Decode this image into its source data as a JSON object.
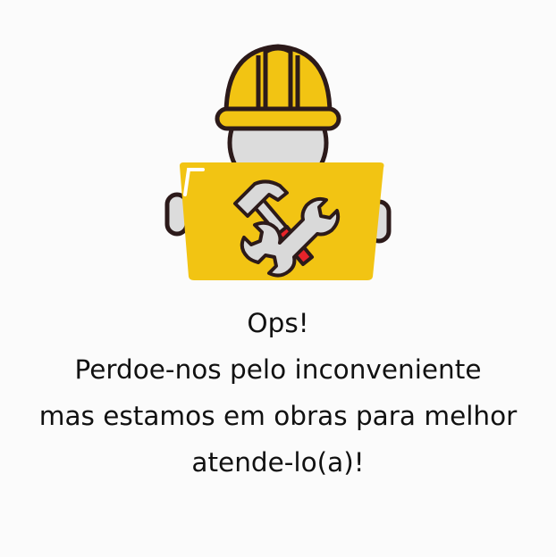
{
  "message": {
    "line1": "Ops!",
    "line2": "Perdoe-nos pelo inconveniente",
    "line3": "mas estamos em obras para melhor",
    "line4": "atende-lo(a)!"
  },
  "illustration": {
    "icon": "construction-worker-icon",
    "tools_icon": "hammer-wrench-icon",
    "colors": {
      "helmet": "#f2c413",
      "sign": "#f2c413",
      "outline": "#2c1a1a",
      "face": "#dcdcdc",
      "hammer_handle": "#e8232a",
      "tool_metal": "#d9d9d9"
    }
  }
}
